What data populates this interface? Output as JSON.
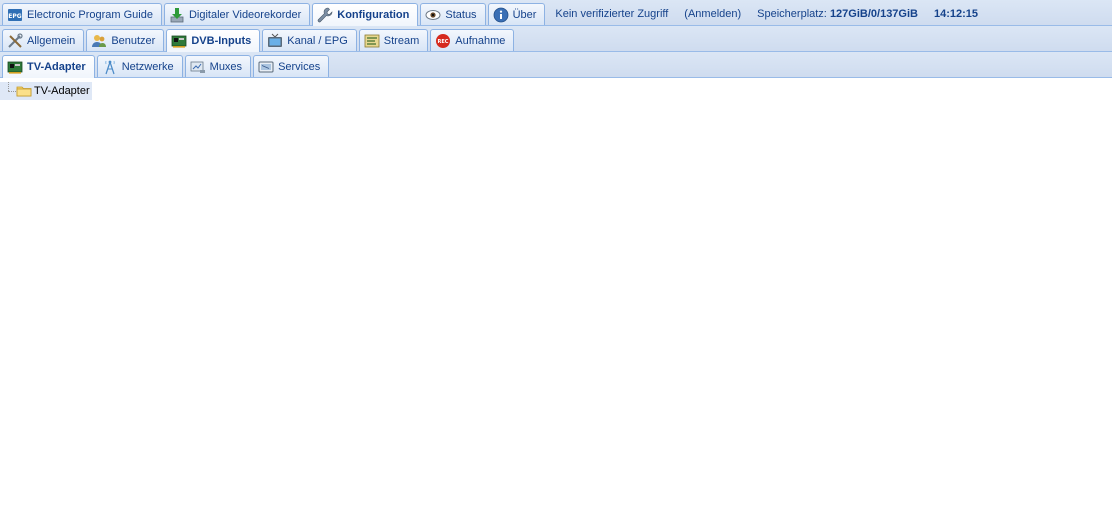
{
  "main_tabs": [
    {
      "label": "Electronic Program Guide",
      "icon": "epg-icon",
      "active": false
    },
    {
      "label": "Digitaler Videorekorder",
      "icon": "download-icon",
      "active": false
    },
    {
      "label": "Konfiguration",
      "icon": "wrench-icon",
      "active": true
    },
    {
      "label": "Status",
      "icon": "eye-icon",
      "active": false
    },
    {
      "label": "Über",
      "icon": "info-icon",
      "active": false
    }
  ],
  "status": {
    "access": "Kein verifizierter Zugriff",
    "login": "(Anmelden)",
    "storage_label": "Speicherplatz:",
    "storage_value": "127GiB/0/137GiB",
    "time": "14:12:15"
  },
  "config_tabs": [
    {
      "label": "Allgemein",
      "icon": "tools-icon",
      "active": false
    },
    {
      "label": "Benutzer",
      "icon": "users-icon",
      "active": false
    },
    {
      "label": "DVB-Inputs",
      "icon": "tv-card-icon",
      "active": true
    },
    {
      "label": "Kanal / EPG",
      "icon": "tv-icon",
      "active": false
    },
    {
      "label": "Stream",
      "icon": "stream-icon",
      "active": false
    },
    {
      "label": "Aufnahme",
      "icon": "rec-icon",
      "active": false
    }
  ],
  "dvb_tabs": [
    {
      "label": "TV-Adapter",
      "icon": "tv-card-icon",
      "active": true
    },
    {
      "label": "Netzwerke",
      "icon": "antenna-icon",
      "active": false
    },
    {
      "label": "Muxes",
      "icon": "satellite-icon",
      "active": false
    },
    {
      "label": "Services",
      "icon": "services-icon",
      "active": false
    }
  ],
  "tree": {
    "root_label": "TV-Adapter"
  },
  "colors": {
    "tab_text": "#15428b",
    "tab_border": "#8db2e3",
    "bar_bg": "#d3e1f1",
    "tree_selected": "#dfe8f6"
  }
}
